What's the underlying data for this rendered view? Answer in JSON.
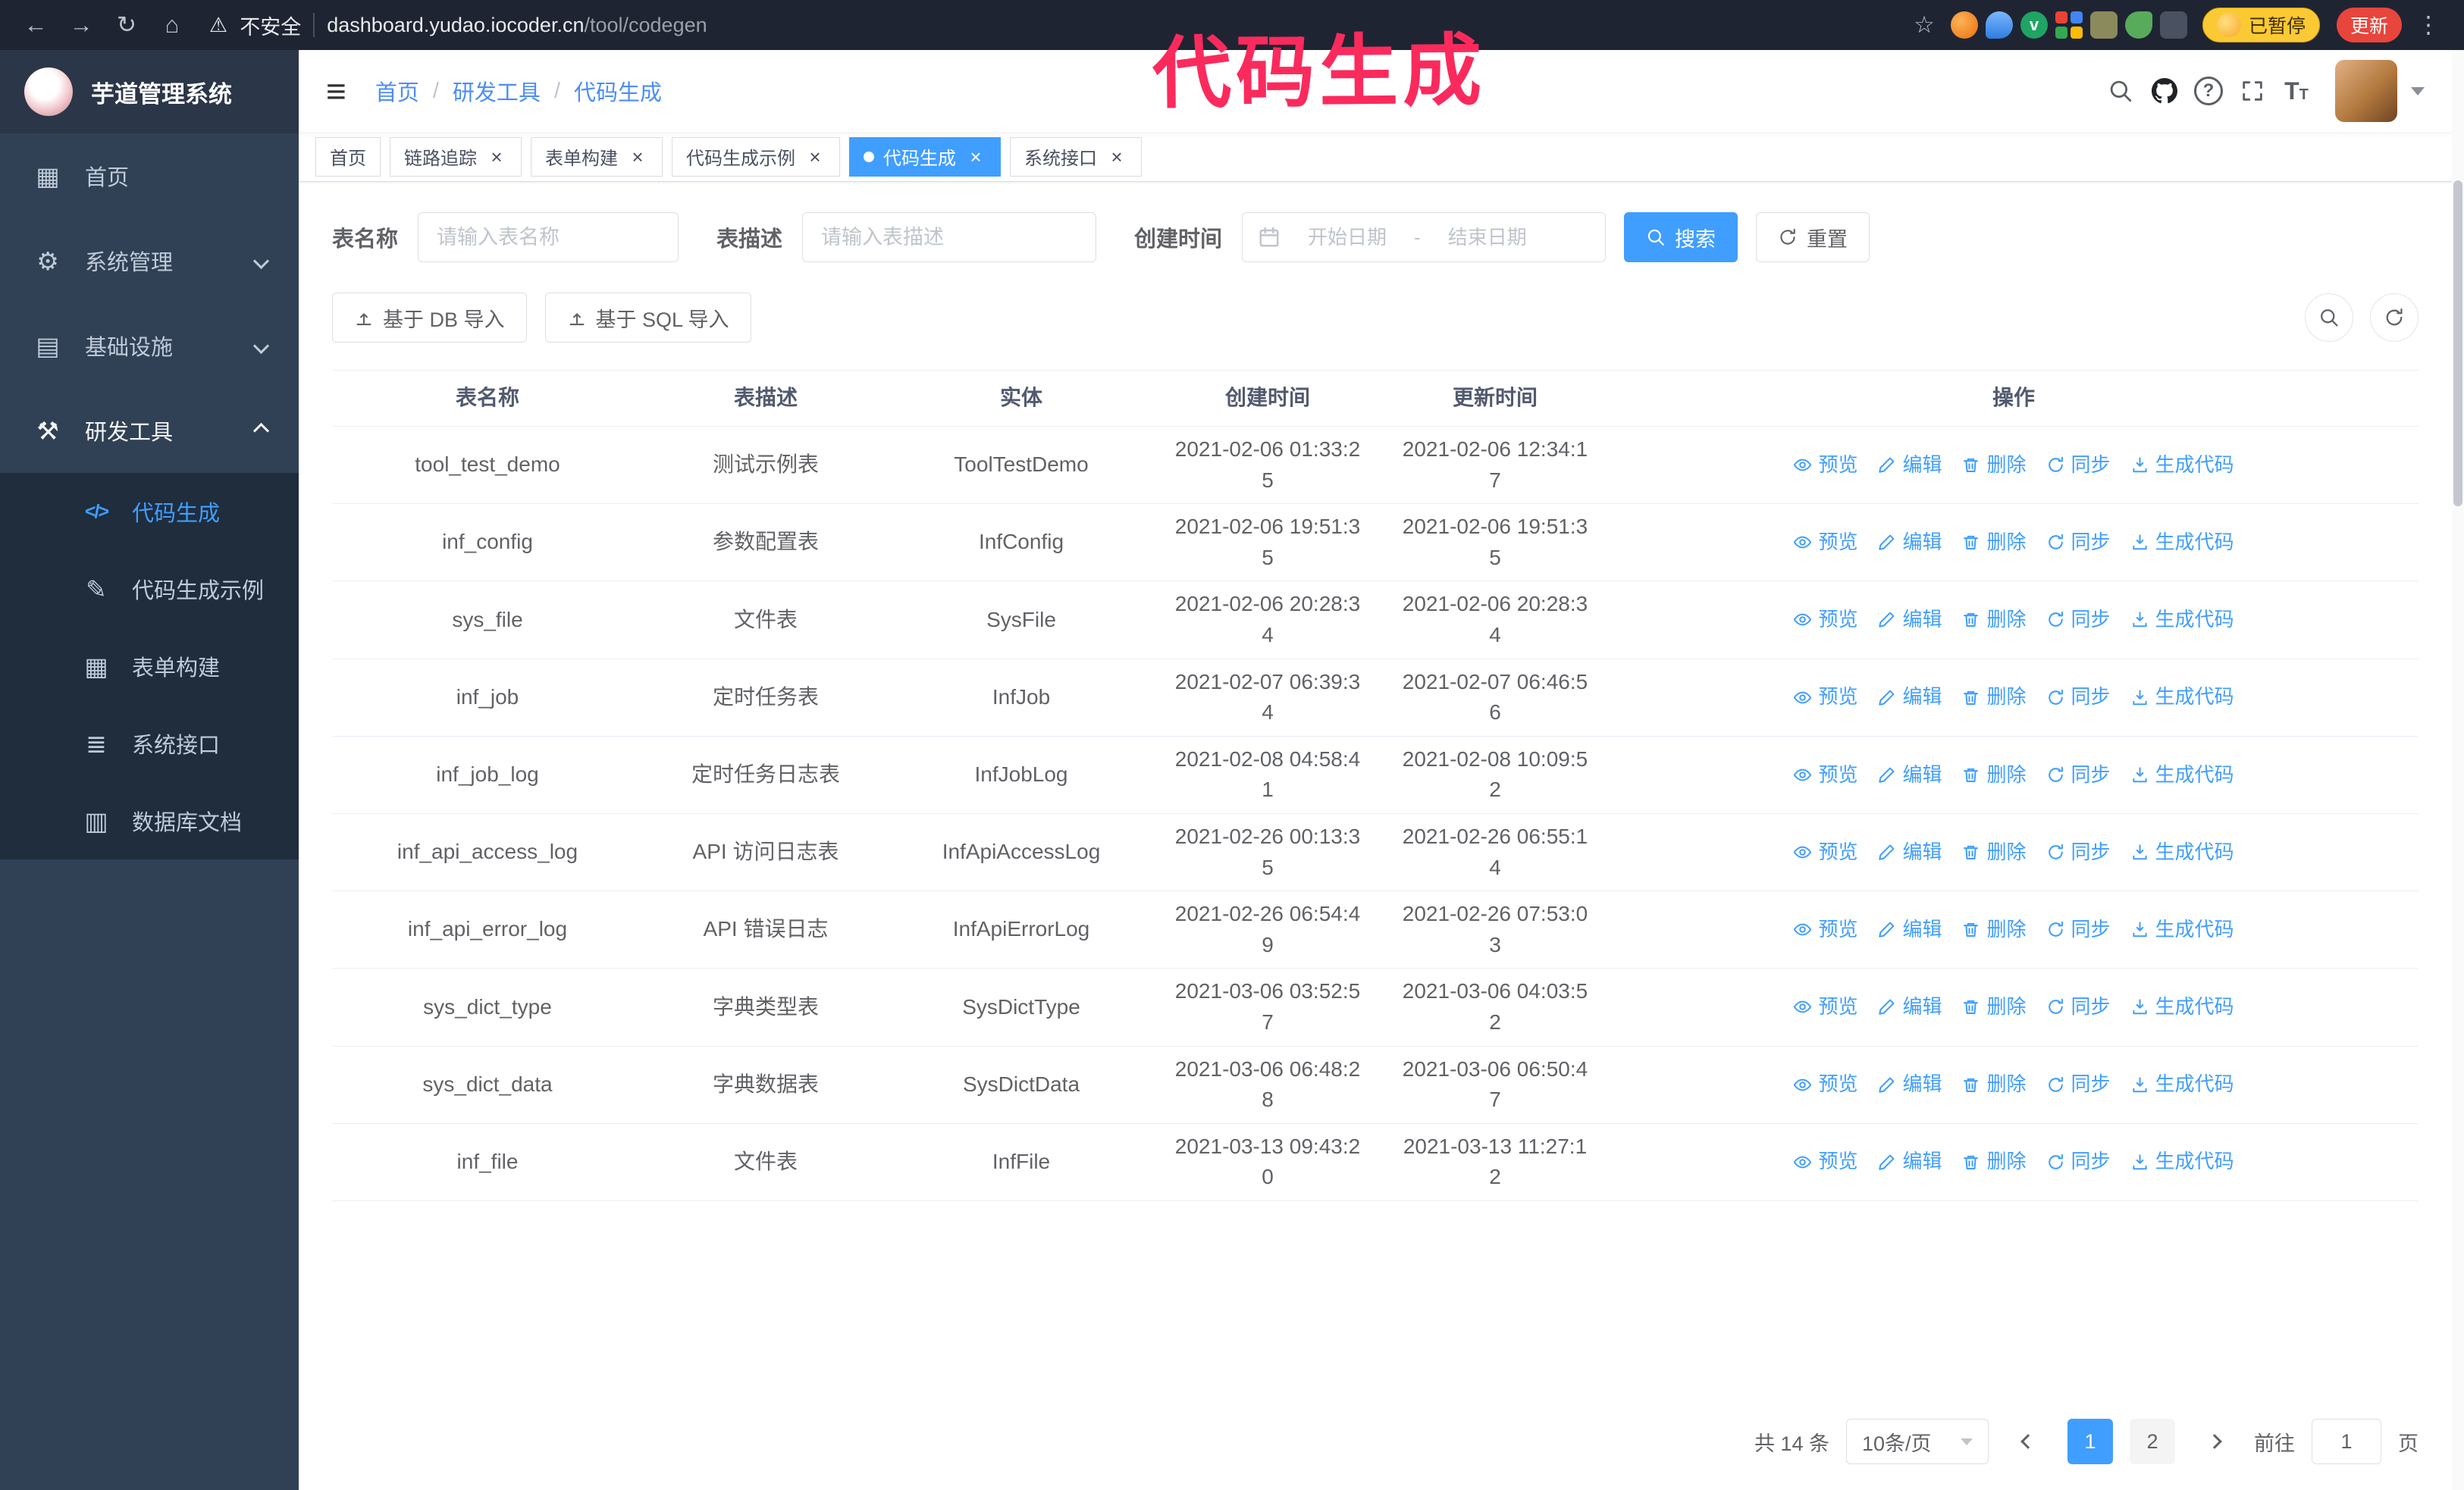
{
  "annotation": {
    "text": "代码生成"
  },
  "browser": {
    "security_warning": "不安全",
    "url_host": "dashboard.yudao.iocoder.cn",
    "url_path": "/tool/codegen",
    "paused_badge": "已暂停",
    "update_button": "更新"
  },
  "ui": {
    "close_icon": "×"
  },
  "sidebar": {
    "logo_title": "芋道管理系统",
    "items": [
      {
        "label": "首页"
      },
      {
        "label": "系统管理"
      },
      {
        "label": "基础设施"
      },
      {
        "label": "研发工具"
      }
    ],
    "submenu": [
      {
        "label": "代码生成",
        "active": true
      },
      {
        "label": "代码生成示例"
      },
      {
        "label": "表单构建"
      },
      {
        "label": "系统接口"
      },
      {
        "label": "数据库文档"
      }
    ]
  },
  "header": {
    "breadcrumb": {
      "home": "首页",
      "section": "研发工具",
      "page": "代码生成",
      "separator": "/"
    }
  },
  "tabs": [
    {
      "label": "首页"
    },
    {
      "label": "链路追踪"
    },
    {
      "label": "表单构建"
    },
    {
      "label": "代码生成示例"
    },
    {
      "label": "代码生成"
    },
    {
      "label": "系统接口"
    }
  ],
  "filters": {
    "table_name_label": "表名称",
    "table_name_placeholder": "请输入表名称",
    "table_desc_label": "表描述",
    "table_desc_placeholder": "请输入表描述",
    "create_time_label": "创建时间",
    "start_date_placeholder": "开始日期",
    "end_date_placeholder": "结束日期",
    "range_separator": "-",
    "search_button": "搜索",
    "reset_button": "重置"
  },
  "toolbar": {
    "import_db": "基于 DB 导入",
    "import_sql": "基于 SQL 导入"
  },
  "table": {
    "columns": [
      "表名称",
      "表描述",
      "实体",
      "创建时间",
      "更新时间",
      "操作"
    ],
    "actions": [
      "预览",
      "编辑",
      "删除",
      "同步",
      "生成代码"
    ],
    "rows": [
      {
        "name": "tool_test_demo",
        "desc": "测试示例表",
        "entity": "ToolTestDemo",
        "created": "2021-02-06 01:33:25",
        "updated": "2021-02-06 12:34:17"
      },
      {
        "name": "inf_config",
        "desc": "参数配置表",
        "entity": "InfConfig",
        "created": "2021-02-06 19:51:35",
        "updated": "2021-02-06 19:51:35"
      },
      {
        "name": "sys_file",
        "desc": "文件表",
        "entity": "SysFile",
        "created": "2021-02-06 20:28:34",
        "updated": "2021-02-06 20:28:34"
      },
      {
        "name": "inf_job",
        "desc": "定时任务表",
        "entity": "InfJob",
        "created": "2021-02-07 06:39:34",
        "updated": "2021-02-07 06:46:56"
      },
      {
        "name": "inf_job_log",
        "desc": "定时任务日志表",
        "entity": "InfJobLog",
        "created": "2021-02-08 04:58:41",
        "updated": "2021-02-08 10:09:52"
      },
      {
        "name": "inf_api_access_log",
        "desc": "API 访问日志表",
        "entity": "InfApiAccessLog",
        "created": "2021-02-26 00:13:35",
        "updated": "2021-02-26 06:55:14"
      },
      {
        "name": "inf_api_error_log",
        "desc": "API 错误日志",
        "entity": "InfApiErrorLog",
        "created": "2021-02-26 06:54:49",
        "updated": "2021-02-26 07:53:03"
      },
      {
        "name": "sys_dict_type",
        "desc": "字典类型表",
        "entity": "SysDictType",
        "created": "2021-03-06 03:52:57",
        "updated": "2021-03-06 04:03:52"
      },
      {
        "name": "sys_dict_data",
        "desc": "字典数据表",
        "entity": "SysDictData",
        "created": "2021-03-06 06:48:28",
        "updated": "2021-03-06 06:50:47"
      },
      {
        "name": "inf_file",
        "desc": "文件表",
        "entity": "InfFile",
        "created": "2021-03-13 09:43:20",
        "updated": "2021-03-13 11:27:12"
      }
    ]
  },
  "pagination": {
    "total_label": "共 14 条",
    "page_size": "10条/页",
    "pages": [
      "1",
      "2"
    ],
    "goto_label": "前往",
    "goto_value": "1",
    "goto_suffix": "页"
  }
}
